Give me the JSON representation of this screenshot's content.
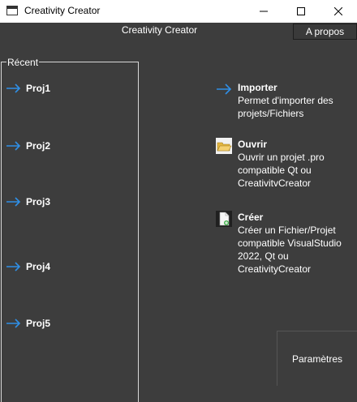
{
  "window": {
    "title": "Creativity Creator"
  },
  "header": {
    "title": "Creativity Creator",
    "about_label": "A propos"
  },
  "recent": {
    "legend": "Récent",
    "items": [
      {
        "label": "Proj1"
      },
      {
        "label": "Proj2"
      },
      {
        "label": "Proj3"
      },
      {
        "label": "Proj4"
      },
      {
        "label": "Proj5"
      }
    ]
  },
  "actions": {
    "import": {
      "title": "Importer",
      "desc": [
        "Permet d'importer des",
        "projets/Fichiers"
      ]
    },
    "open": {
      "title": "Ouvrir",
      "desc": [
        "Ouvrir un projet .pro",
        "compatible Qt ou",
        "CreativitvCreator"
      ]
    },
    "create": {
      "title": "Créer",
      "desc": [
        "Créer un Fichier/Projet",
        "compatible VisualStudio",
        "2022, Qt ou",
        "CreativityCreator"
      ]
    }
  },
  "footer": {
    "settings_label": "Paramètres"
  },
  "colors": {
    "accent_arrow": "#2f8fe6",
    "background": "#3d3d3d",
    "titlebar": "#ffffff"
  }
}
